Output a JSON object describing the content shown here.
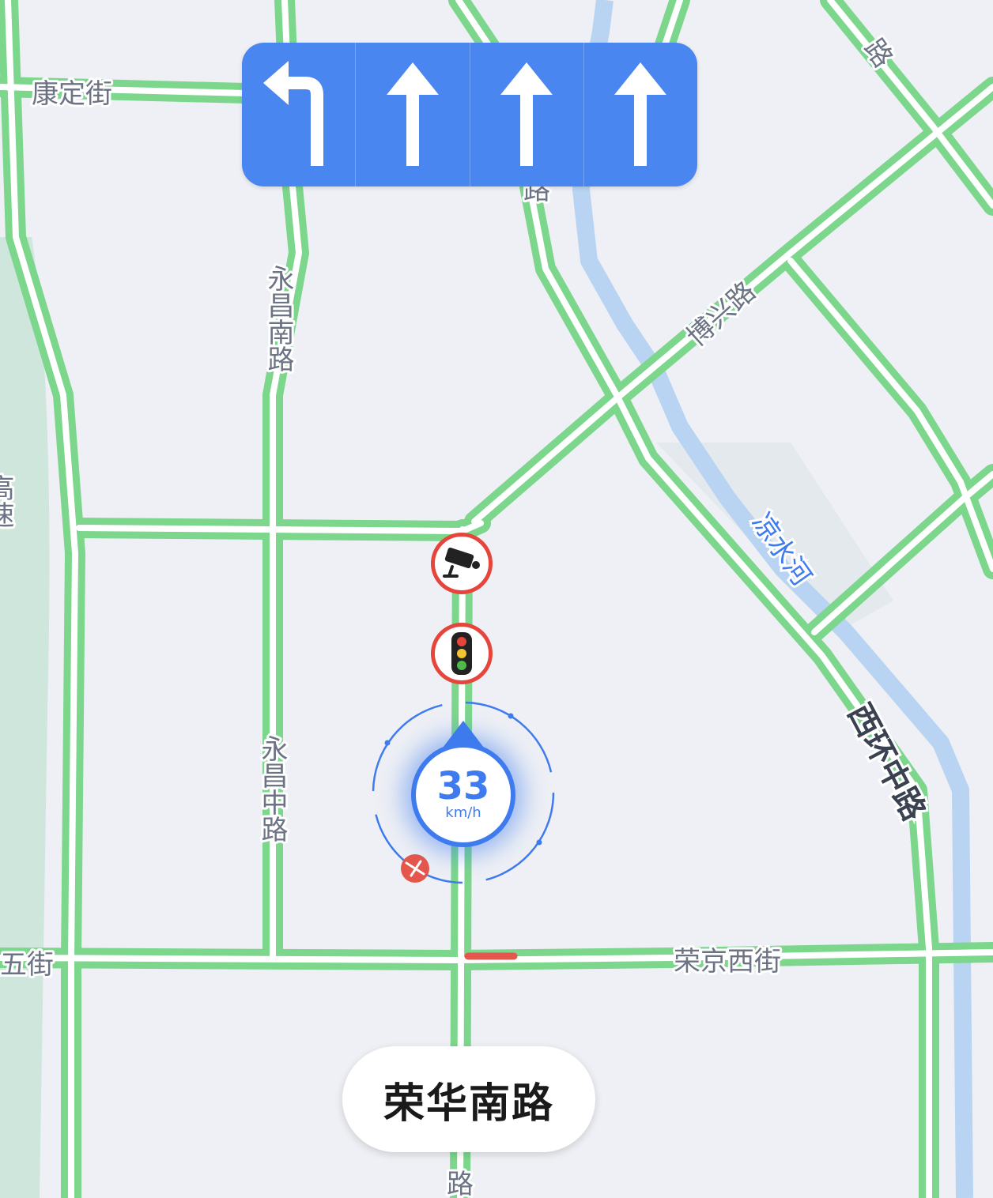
{
  "lane_guidance": {
    "lanes": [
      {
        "direction": "left",
        "icon": "turn-left-arrow-icon"
      },
      {
        "direction": "straight",
        "icon": "straight-arrow-icon"
      },
      {
        "direction": "straight",
        "icon": "straight-arrow-icon"
      },
      {
        "direction": "straight",
        "icon": "straight-arrow-icon"
      }
    ],
    "color": "#4a86f0"
  },
  "map_labels": {
    "kangding_street": "康定街",
    "yongchang_south_road": "永昌南路",
    "yongchang_middle_road": "永昌中路",
    "boxing_road": "博兴路",
    "liangshui_river": "凉水河",
    "xihuan_middle_road": "西环中路",
    "rongjing_west_street": "荣京西街",
    "wu_street": "五街",
    "highway_left": "高速",
    "road_top_right": "路",
    "road_under_panel": "路",
    "road_bottom": "路"
  },
  "navigation": {
    "current_road": "荣华南路",
    "speed_value": "33",
    "speed_unit": "km/h"
  },
  "icons": {
    "camera": "speed-camera-icon",
    "traffic_light": "traffic-light-icon",
    "incident": "incident-icon"
  },
  "colors": {
    "road": "#7cd68c",
    "river": "#b8d4f2",
    "background": "#eef0f5",
    "congestion": "#e5574c",
    "accent": "#3e7bef"
  }
}
